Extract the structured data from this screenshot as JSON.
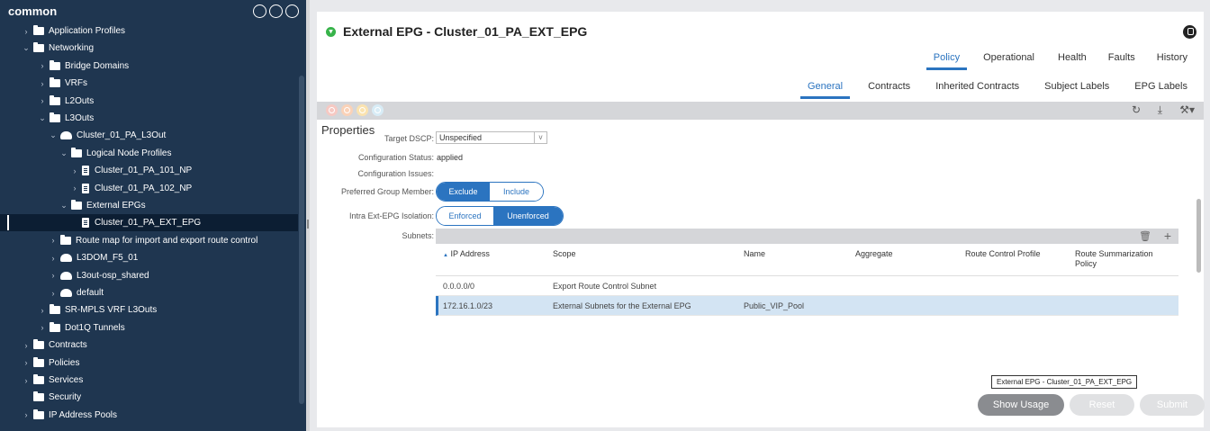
{
  "sidebar": {
    "title": "common",
    "items": [
      {
        "label": "Application Profiles",
        "chev": ">",
        "icon": "folder"
      },
      {
        "label": "Networking",
        "chev": "v",
        "icon": "folder"
      },
      {
        "label": "Bridge Domains",
        "chev": ">",
        "icon": "folder"
      },
      {
        "label": "VRFs",
        "chev": ">",
        "icon": "folder"
      },
      {
        "label": "L2Outs",
        "chev": ">",
        "icon": "folder"
      },
      {
        "label": "L3Outs",
        "chev": "v",
        "icon": "folder"
      },
      {
        "label": "Cluster_01_PA_L3Out",
        "chev": "v",
        "icon": "cloud"
      },
      {
        "label": "Logical Node Profiles",
        "chev": "v",
        "icon": "folder"
      },
      {
        "label": "Cluster_01_PA_101_NP",
        "chev": ">",
        "icon": "doc"
      },
      {
        "label": "Cluster_01_PA_102_NP",
        "chev": ">",
        "icon": "doc"
      },
      {
        "label": "External EPGs",
        "chev": "v",
        "icon": "folder"
      },
      {
        "label": "Cluster_01_PA_EXT_EPG",
        "chev": "",
        "icon": "doc"
      },
      {
        "label": "Route map for import and export route control",
        "chev": ">",
        "icon": "folder"
      },
      {
        "label": "L3DOM_F5_01",
        "chev": ">",
        "icon": "cloud"
      },
      {
        "label": "L3out-osp_shared",
        "chev": ">",
        "icon": "cloud"
      },
      {
        "label": "default",
        "chev": ">",
        "icon": "cloud"
      },
      {
        "label": "SR-MPLS VRF L3Outs",
        "chev": ">",
        "icon": "folder"
      },
      {
        "label": "Dot1Q Tunnels",
        "chev": ">",
        "icon": "folder"
      },
      {
        "label": "Contracts",
        "chev": ">",
        "icon": "folder"
      },
      {
        "label": "Policies",
        "chev": ">",
        "icon": "folder"
      },
      {
        "label": "Services",
        "chev": ">",
        "icon": "folder"
      },
      {
        "label": "Security",
        "chev": "",
        "icon": "folder"
      },
      {
        "label": "IP Address Pools",
        "chev": ">",
        "icon": "folder"
      }
    ],
    "selected_index": 11
  },
  "main": {
    "title": "External EPG - Cluster_01_PA_EXT_EPG",
    "tabs_primary": [
      "Policy",
      "Operational",
      "Health",
      "Faults",
      "History"
    ],
    "tabs_primary_active": "Policy",
    "tabs_secondary": [
      "General",
      "Contracts",
      "Inherited Contracts",
      "Subject Labels",
      "EPG Labels"
    ],
    "tabs_secondary_active": "General"
  },
  "properties": {
    "heading": "Properties",
    "target_dscp_label": "Target DSCP:",
    "target_dscp_value": "Unspecified",
    "config_status_label": "Configuration Status:",
    "config_status_value": "applied",
    "config_issues_label": "Configuration Issues:",
    "preferred_group_label": "Preferred Group Member:",
    "preferred_group_options": [
      "Exclude",
      "Include"
    ],
    "preferred_group_selected": "Exclude",
    "isolation_label": "Intra Ext-EPG Isolation:",
    "isolation_options": [
      "Enforced",
      "Unenforced"
    ],
    "isolation_selected": "Unenforced",
    "subnets_label": "Subnets:"
  },
  "subnets_table": {
    "headers": [
      "IP Address",
      "Scope",
      "Name",
      "Aggregate",
      "Route Control Profile",
      "Route Summarization Policy"
    ],
    "sort_indicator": "▲",
    "rows": [
      {
        "ip": "0.0.0.0/0",
        "scope": "Export Route Control Subnet",
        "name": "",
        "aggregate": "",
        "rcp": "",
        "rsp": ""
      },
      {
        "ip": "172.16.1.0/23",
        "scope": "External Subnets for the External EPG",
        "name": "Public_VIP_Pool",
        "aggregate": "",
        "rcp": "",
        "rsp": ""
      }
    ],
    "selected_row": 1
  },
  "tooltip": "External EPG - Cluster_01_PA_EXT_EPG",
  "buttons": {
    "show_usage": "Show Usage",
    "reset": "Reset",
    "submit": "Submit"
  },
  "colors": {
    "accent": "#2b74c0",
    "sidebar_bg": "#1f3650",
    "healthy_green": "#37b34a"
  }
}
